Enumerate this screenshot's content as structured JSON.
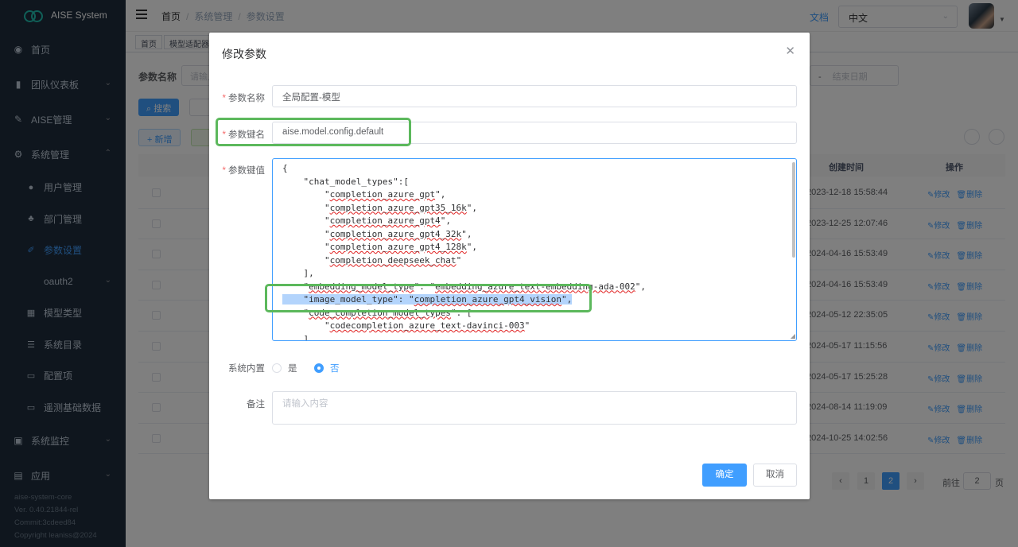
{
  "app": {
    "title": "AISE System"
  },
  "sidebar": {
    "items": [
      {
        "label": "首页",
        "icon": "dashboard-icon"
      },
      {
        "label": "团队仪表板",
        "icon": "bar-chart-icon"
      },
      {
        "label": "AISE管理",
        "icon": "tool-icon"
      },
      {
        "label": "系统管理",
        "icon": "gear-icon"
      }
    ],
    "sub_items": [
      {
        "label": "用户管理",
        "icon": "user-icon"
      },
      {
        "label": "部门管理",
        "icon": "tree-icon"
      },
      {
        "label": "参数设置",
        "icon": "edit-icon"
      },
      {
        "label": "oauth2",
        "icon": ""
      },
      {
        "label": "模型类型",
        "icon": "grid-icon"
      },
      {
        "label": "系统目录",
        "icon": "list-icon"
      },
      {
        "label": "配置项",
        "icon": "briefcase-icon"
      },
      {
        "label": "遥测基础数据",
        "icon": "monitor-icon"
      }
    ],
    "bottom_items": [
      {
        "label": "系统监控",
        "icon": "monitor-icon"
      },
      {
        "label": "应用",
        "icon": "folder-icon"
      }
    ],
    "footer": [
      "aise-system-core",
      "Ver. 0.40.21844-rel",
      "Commit:3cdeed84",
      "Copyright leaniss@2024"
    ]
  },
  "header": {
    "breadcrumb": [
      "首页",
      "系统管理",
      "参数设置"
    ],
    "doc_link": "文档",
    "language": "中文"
  },
  "tags": [
    "首页",
    "模型适配器"
  ],
  "page": {
    "query_label": "参数名称",
    "query_placeholder": "请输入",
    "end_date_placeholder": "结束日期",
    "date_sep": "-",
    "search_btn": "搜索",
    "add_btn": "新增",
    "col_created": "创建时间",
    "col_ops": "操作",
    "op_edit": "修改",
    "op_delete": "删除",
    "rows": [
      "2023-12-18 15:58:44",
      "2023-12-25 12:07:46",
      "2024-04-16 15:53:49",
      "2024-04-16 15:53:49",
      "2024-05-12 22:35:05",
      "2024-05-17 11:15:56",
      "2024-05-17 15:25:28",
      "2024-08-14 11:19:09",
      "2024-10-25 14:02:56"
    ],
    "pagination": {
      "pages": [
        "1",
        "2"
      ],
      "current": "2",
      "goto_label": "前往",
      "goto_value": "2",
      "page_suffix": "页"
    }
  },
  "dialog": {
    "title": "修改参数",
    "name_label": "参数名称",
    "name_value": "全局配置-模型",
    "key_label": "参数键名",
    "key_value": "aise.model.config.default",
    "value_label": "参数键值",
    "value_lines": [
      "{",
      "    \"chat_model_types\":[",
      "        \"completion_azure_gpt\",",
      "        \"completion_azure_gpt35_16k\",",
      "        \"completion_azure_gpt4\",",
      "        \"completion_azure_gpt4_32k\",",
      "        \"completion_azure_gpt4_128k\",",
      "        \"completion_deepseek_chat\"",
      "    ],",
      "    \"embedding_model_type\": \"embedding_azure_text-embedding-ada-002\",",
      "    \"image_model_type\": \"completion_azure_gpt4_vision\",",
      "    \"code_completion_model_types\": [",
      "        \"codecompletion_azure_text-davinci-003\"",
      "    ]"
    ],
    "builtin_label": "系统内置",
    "builtin_yes": "是",
    "builtin_no": "否",
    "builtin_selected": "否",
    "remark_label": "备注",
    "remark_placeholder": "请输入内容",
    "confirm_btn": "确定",
    "cancel_btn": "取消"
  },
  "colors": {
    "primary": "#409eff",
    "sidebar_bg": "#1f2d3d",
    "highlight_box": "#5cb85c",
    "required": "#f56c6c"
  }
}
